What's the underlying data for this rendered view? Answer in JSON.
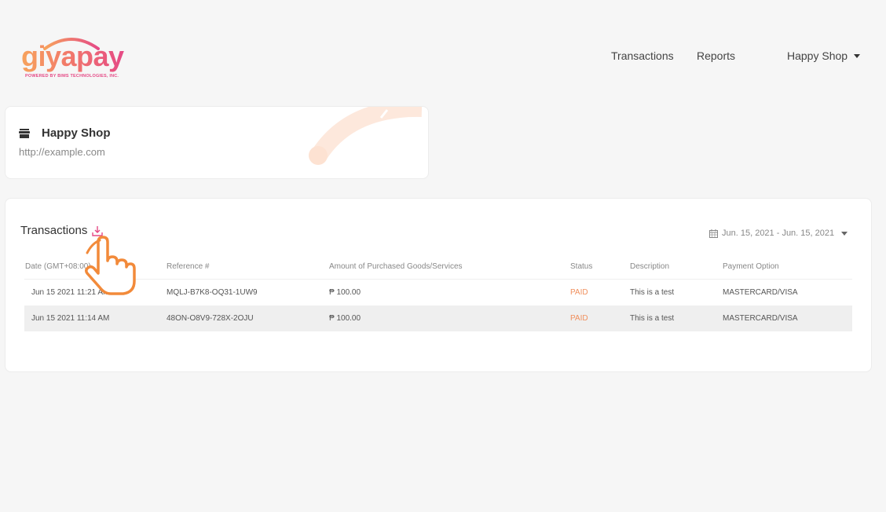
{
  "brand": {
    "logo_text": "giyapay",
    "tagline": "POWERED BY BIMS TECHNOLOGIES, INC."
  },
  "nav": {
    "transactions": "Transactions",
    "reports": "Reports",
    "user": "Happy Shop"
  },
  "shop": {
    "name": "Happy Shop",
    "url": "http://example.com"
  },
  "transactions": {
    "title": "Transactions",
    "date_range": "Jun. 15, 2021 - Jun. 15, 2021",
    "columns": [
      "Date (GMT+08:00)",
      "Reference #",
      "Amount of Purchased Goods/Services",
      "Status",
      "Description",
      "Payment Option"
    ],
    "rows": [
      {
        "date": "Jun 15 2021 11:21 AM",
        "ref": "MQLJ-B7K8-OQ31-1UW9",
        "amount": "₱ 100.00",
        "status": "PAID",
        "description": "This is a test",
        "payment": "MASTERCARD/VISA"
      },
      {
        "date": "Jun 15 2021 11:14 AM",
        "ref": "48ON-O8V9-728X-2OJU",
        "amount": "₱ 100.00",
        "status": "PAID",
        "description": "This is a test",
        "payment": "MASTERCARD/VISA"
      }
    ]
  },
  "colors": {
    "accent_pink": "#e54a86",
    "accent_orange": "#f7a35c",
    "status_paid": "#f0905e"
  }
}
